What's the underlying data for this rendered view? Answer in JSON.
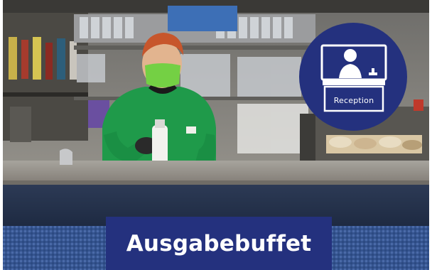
{
  "photo": {
    "subject": "staff-member-at-buffet-counter",
    "colors": {
      "shirt": "#1f9a4a",
      "mask": "#74d044",
      "counter": "#8b8a86",
      "carpet": "#3a5c9c"
    }
  },
  "badge": {
    "label": "Reception",
    "icon": "reception-desk-icon",
    "background": "#24317e",
    "foreground": "#ffffff"
  },
  "banner": {
    "label": "Ausgabebuffet",
    "background": "#24317e",
    "text_color": "#ffffff"
  }
}
